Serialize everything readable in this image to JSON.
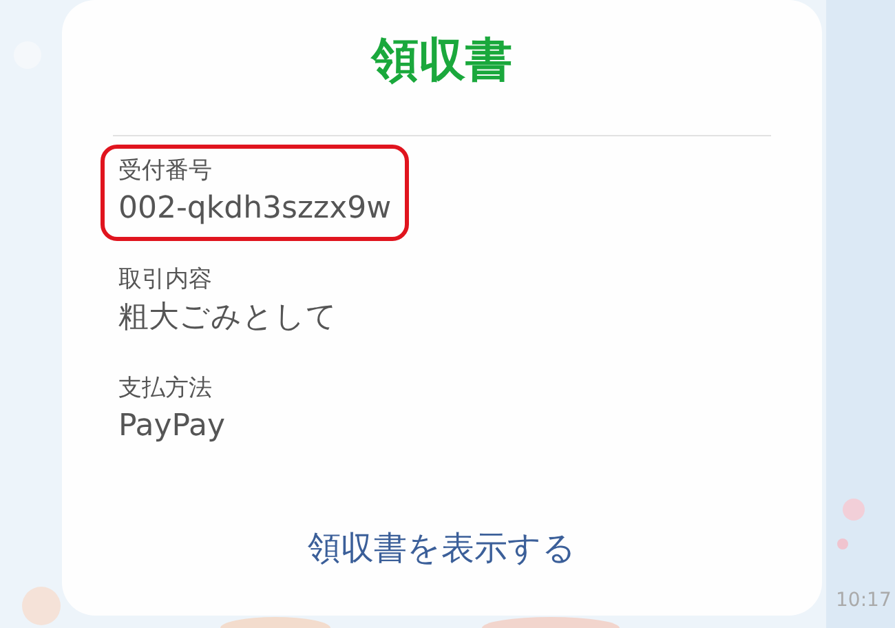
{
  "message": {
    "title": "領収書",
    "fields": [
      {
        "label": "受付番号",
        "value": "002-qkdh3szzx9w",
        "highlighted": true
      },
      {
        "label": "取引内容",
        "value": "粗大ごみとして",
        "highlighted": false
      },
      {
        "label": "支払方法",
        "value": "PayPay",
        "highlighted": false
      }
    ],
    "link": "領収書を表示する",
    "time": "10:17"
  }
}
